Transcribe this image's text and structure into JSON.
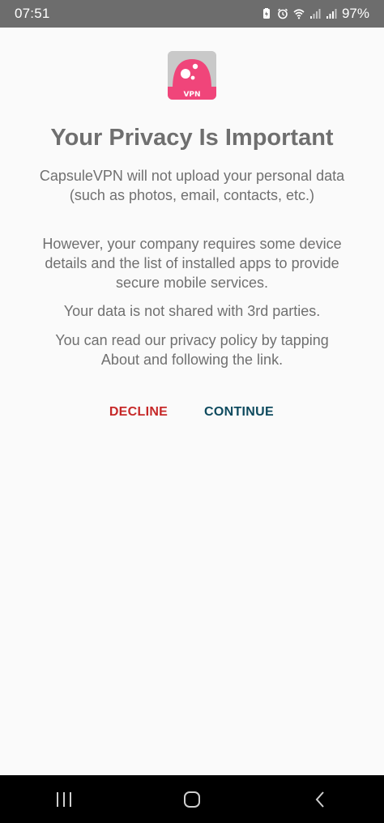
{
  "status_bar": {
    "time": "07:51",
    "battery": "97%",
    "icons": [
      "battery-saver-icon",
      "alarm-icon",
      "wifi-icon",
      "signal-icon",
      "signal-icon"
    ]
  },
  "app": {
    "logo_badge": "VPN",
    "logo_color": "#f0457a"
  },
  "dialog": {
    "title": "Your Privacy Is Important",
    "paragraphs": [
      "CapsuleVPN will not upload your personal data (such as photos, email, contacts, etc.)",
      "However, your company requires some device details and the list of installed apps to provide secure mobile services.",
      "Your data is not shared with 3rd parties.",
      "You can read our privacy policy by tapping About and following the link."
    ],
    "decline_label": "DECLINE",
    "continue_label": "CONTINUE",
    "decline_color": "#c62828",
    "continue_color": "#0e4a5e"
  },
  "nav_bar": {
    "buttons": [
      "recent-apps-icon",
      "home-icon",
      "back-icon"
    ]
  }
}
